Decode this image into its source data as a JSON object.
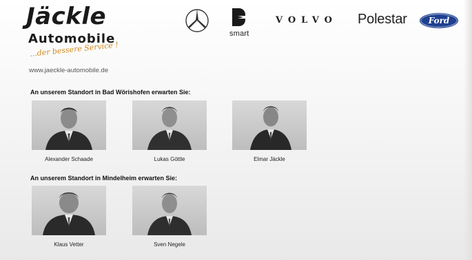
{
  "brand": {
    "name": "Jäckle",
    "subtitle": "Automobile",
    "slogan": "...der bessere Service !",
    "url": "www.jaeckle-automobile.de"
  },
  "logos": {
    "mercedes": "mercedes-star-icon",
    "smart": "smart",
    "volvo": "VOLVO",
    "polestar": "Polestar",
    "ford": "Ford"
  },
  "sections": [
    {
      "title": "An unserem Standort in Bad Wörishofen erwarten Sie:",
      "people": [
        {
          "name": "Alexander Schaade"
        },
        {
          "name": "Lukas Göttle"
        },
        {
          "name": "Elmar Jäckle"
        }
      ]
    },
    {
      "title": "An unserem Standort in Mindelheim erwarten Sie:",
      "people": [
        {
          "name": "Klaus Vetter"
        },
        {
          "name": "Sven Negele"
        }
      ]
    }
  ],
  "colors": {
    "slogan": "#d08a1f",
    "ford_blue": "#1f3f8f",
    "text": "#111111"
  }
}
